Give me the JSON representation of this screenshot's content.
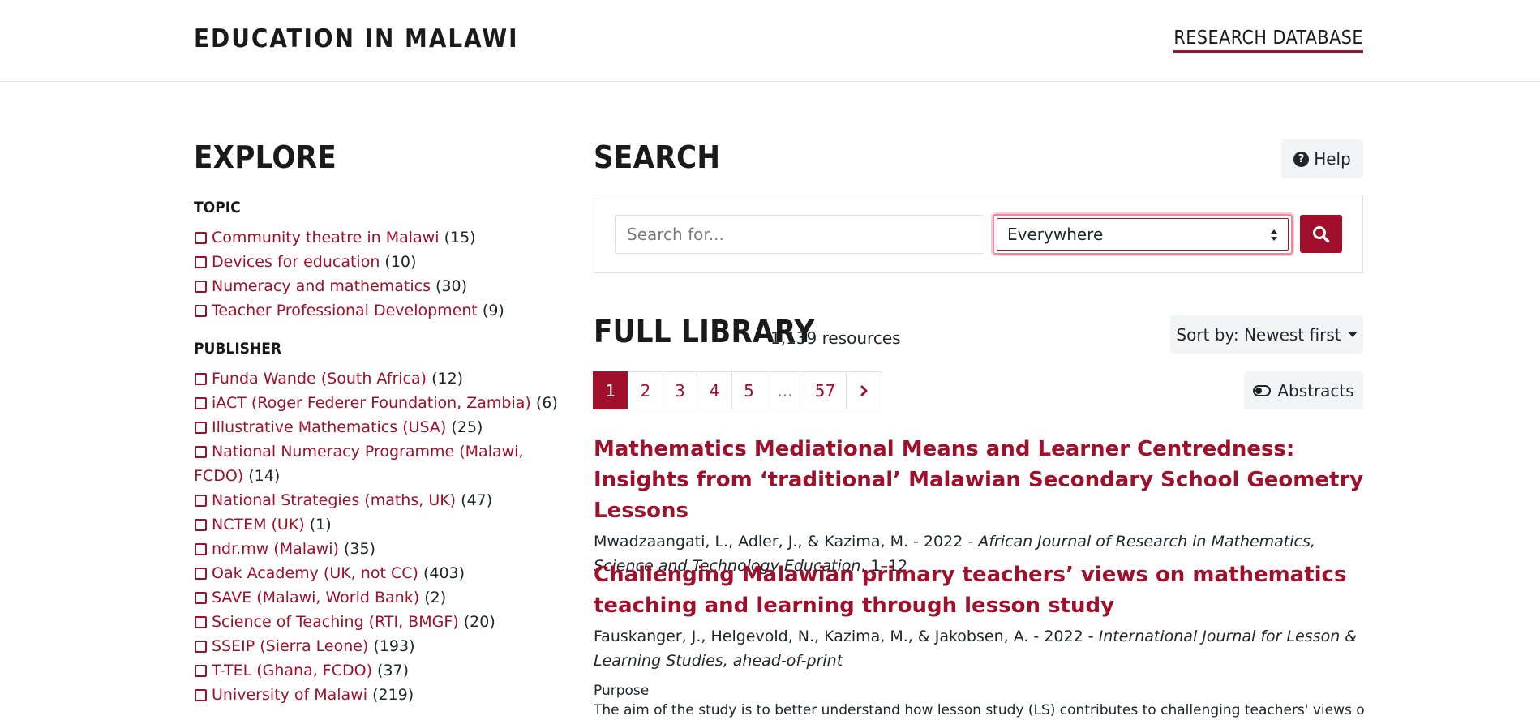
{
  "header": {
    "site_title": "EDUCATION IN MALAWI",
    "nav_link": "RESEARCH DATABASE"
  },
  "explore": {
    "heading": "EXPLORE",
    "topic": {
      "heading": "TOPIC",
      "items": [
        {
          "label": "Community theatre in Malawi",
          "count": "(15)"
        },
        {
          "label": "Devices for education",
          "count": "(10)"
        },
        {
          "label": "Numeracy and mathematics",
          "count": "(30)"
        },
        {
          "label": "Teacher Professional Development",
          "count": "(9)"
        }
      ]
    },
    "publisher": {
      "heading": "PUBLISHER",
      "items": [
        {
          "label": "Funda Wande (South Africa)",
          "count": "(12)"
        },
        {
          "label": "iACT (Roger Federer Foundation, Zambia)",
          "count": "(6)"
        },
        {
          "label": "Illustrative Mathematics (USA)",
          "count": "(25)"
        },
        {
          "label": "National Numeracy Programme (Malawi, FCDO)",
          "count": "(14)"
        },
        {
          "label": "National Strategies (maths, UK)",
          "count": "(47)"
        },
        {
          "label": "NCTEM (UK)",
          "count": "(1)"
        },
        {
          "label": "ndr.mw (Malawi)",
          "count": "(35)"
        },
        {
          "label": "Oak Academy (UK, not CC)",
          "count": "(403)"
        },
        {
          "label": "SAVE (Malawi, World Bank)",
          "count": "(2)"
        },
        {
          "label": "Science of Teaching (RTI, BMGF)",
          "count": "(20)"
        },
        {
          "label": "SSEIP (Sierra Leone)",
          "count": "(193)"
        },
        {
          "label": "T-TEL (Ghana, FCDO)",
          "count": "(37)"
        },
        {
          "label": "University of Malawi",
          "count": "(219)"
        }
      ]
    }
  },
  "search": {
    "heading": "SEARCH",
    "help_label": "Help",
    "input_placeholder": "Search for...",
    "scope_selected": "Everywhere"
  },
  "library": {
    "heading": "FULL LIBRARY",
    "count": "1,139 resources",
    "sort_label": "Sort by: Newest first",
    "abstracts_label": "Abstracts",
    "pages": [
      "1",
      "2",
      "3",
      "4",
      "5",
      "...",
      "57"
    ],
    "next_icon": "chevron-right"
  },
  "results": [
    {
      "title": "Mathematics Mediational Means and Learner Centredness: Insights from ‘traditional’ Malawian Secondary School Geometry Lessons",
      "authors": "Mwadzaangati, L., Adler, J., & Kazima, M. - 2022 - ",
      "journal": "African Journal of Research in Mathematics, Science and Technology Education",
      "pages": ", 1–12"
    },
    {
      "title": "Challenging Malawian primary teachers’ views on mathematics teaching and learning through lesson study",
      "authors": "Fauskanger, J., Helgevold, N., Kazima, M., & Jakobsen, A. - 2022 - ",
      "journal": "International Journal for Lesson & Learning Studies",
      "pages": ", ahead-of-print",
      "abstract_label": "Purpose",
      "abstract_text": "The aim of the study is to better understand how lesson study (LS) contributes to challenging teachers' views of"
    }
  ]
}
